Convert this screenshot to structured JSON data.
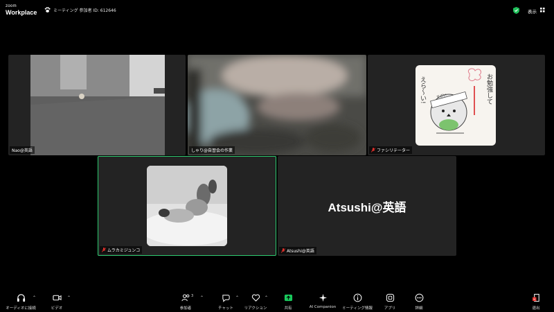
{
  "app": {
    "brand_small": "zoom",
    "brand_main": "Workplace"
  },
  "header": {
    "meeting_label": "ミーティング 参加者 ID: 612646",
    "view_label": "表示"
  },
  "tiles": [
    {
      "name": "Nao@英語",
      "muted": false
    },
    {
      "name": "しゃり@自習会の作業",
      "muted": false
    },
    {
      "name": "ファシリテーター",
      "muted": true
    },
    {
      "name": "ムラカミジュンコ",
      "muted": true,
      "active_speaker": true
    },
    {
      "name": "Atsushi@英語",
      "muted": true,
      "display_name_large": "Atsushi@英語"
    }
  ],
  "sticker": {
    "text_right": "お勉強して",
    "text_left": "えら〜い!",
    "headband": "すごい"
  },
  "toolbar": {
    "audio": "オーディオに接続",
    "video": "ビデオ",
    "participants": "参加者",
    "participants_count": "3",
    "chat": "チャット",
    "reactions": "リアクション",
    "share": "共有",
    "ai": "AI Companion",
    "info": "ミーティング情報",
    "apps": "アプリ",
    "more": "詳細",
    "leave": "退出"
  },
  "colors": {
    "active_border": "#2ecc71",
    "share": "#19c95c",
    "shield": "#1fbf5a",
    "leave": "#e5322d"
  }
}
